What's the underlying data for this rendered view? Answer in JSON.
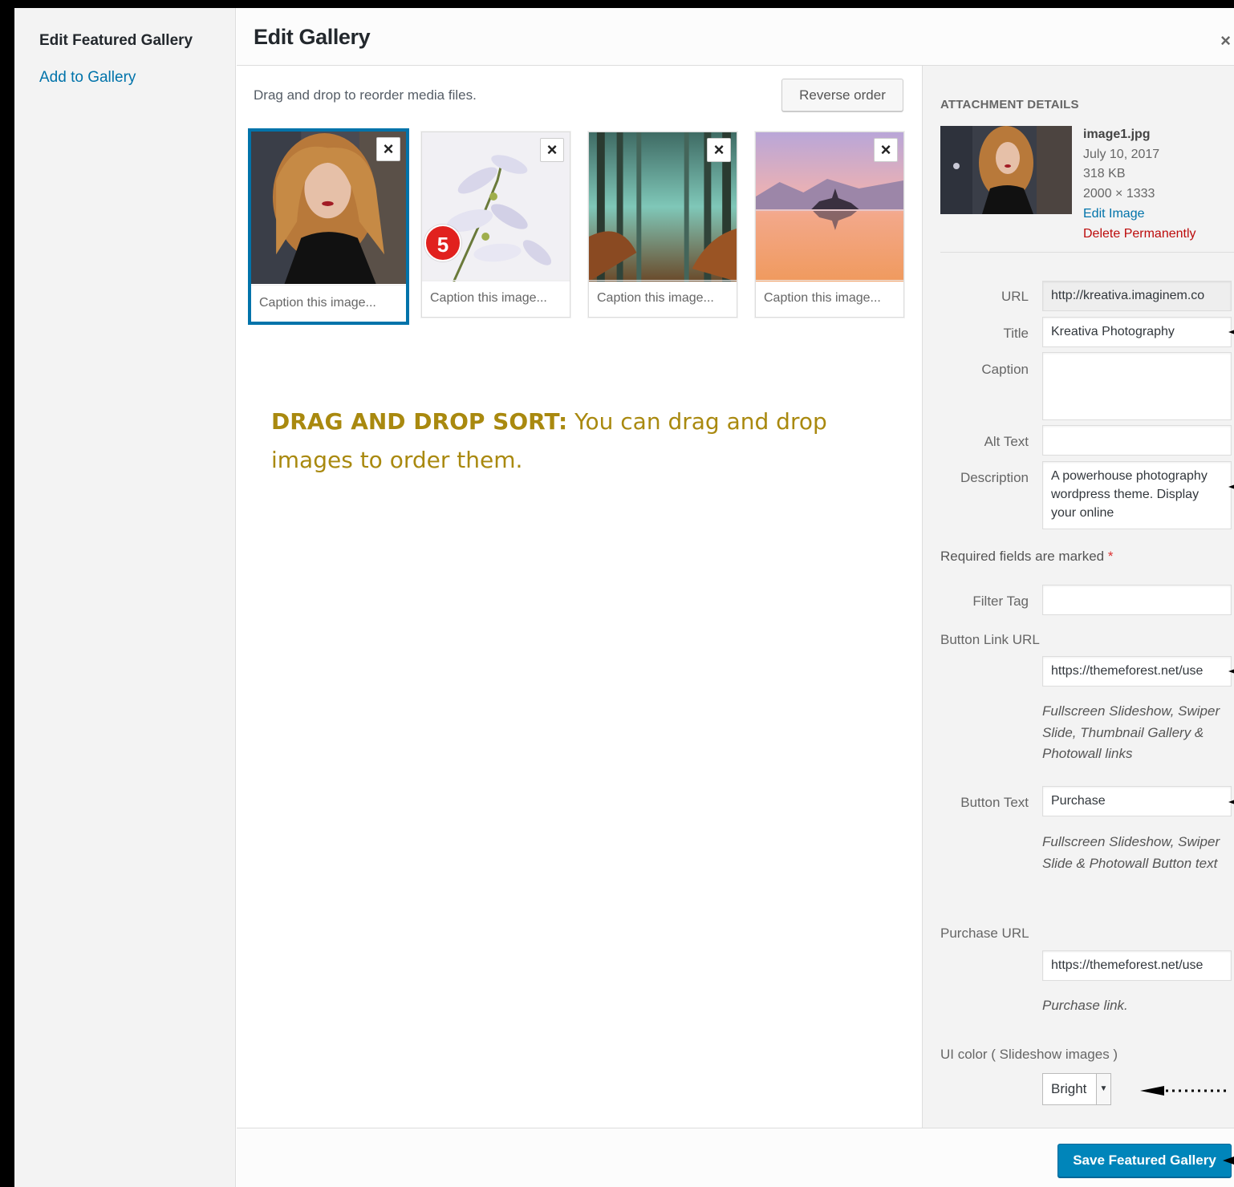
{
  "menu": {
    "heading": "Edit Featured Gallery",
    "add_link": "Add to Gallery"
  },
  "title": "Edit Gallery",
  "close_icon": "×",
  "content": {
    "instructions": "Drag and drop to reorder media files.",
    "reverse_label": "Reverse order",
    "thumbnails": [
      {
        "caption_placeholder": "Caption this image...",
        "remove_icon": "×",
        "selected": true,
        "subject": "portrait-woman"
      },
      {
        "caption_placeholder": "Caption this image...",
        "remove_icon": "×",
        "selected": false,
        "subject": "white-flowers"
      },
      {
        "caption_placeholder": "Caption this image...",
        "remove_icon": "×",
        "selected": false,
        "subject": "misty-forest"
      },
      {
        "caption_placeholder": "Caption this image...",
        "remove_icon": "×",
        "selected": false,
        "subject": "lake-island-sunset"
      }
    ],
    "step_badge": "5",
    "annotation_bold": "DRAG AND DROP SORT:",
    "annotation_text": " You can drag and drop images to order them."
  },
  "sidebar": {
    "section_title": "Attachment Details",
    "filename": "image1.jpg",
    "date": "July 10, 2017",
    "filesize": "318 KB",
    "dimensions": "2000 × 1333",
    "edit_link": "Edit Image",
    "delete_link": "Delete Permanently",
    "fields": {
      "url_label": "URL",
      "url_value": "http://kreativa.imaginem.co",
      "title_label": "Title",
      "title_value": "Kreativa Photography",
      "caption_label": "Caption",
      "caption_value": "",
      "alt_label": "Alt Text",
      "alt_value": "",
      "description_label": "Description",
      "description_value": "A powerhouse photography wordpress theme. Display your online"
    },
    "required_note": "Required fields are marked ",
    "required_star": "*",
    "filter_tag_label": "Filter Tag",
    "filter_tag_value": "",
    "button_link_label": "Button Link URL",
    "button_link_value": "https://themeforest.net/use",
    "button_link_help": "Fullscreen Slideshow, Swiper Slide, Thumbnail Gallery & Photowall links",
    "button_text_label": "Button Text",
    "button_text_value": "Purchase",
    "button_text_help": "Fullscreen Slideshow, Swiper Slide & Photowall Button text",
    "purchase_url_label": "Purchase URL",
    "purchase_url_value": "https://themeforest.net/use",
    "purchase_url_help": "Purchase link.",
    "ui_color_label": "UI color ( Slideshow images )",
    "ui_color_value": "Bright"
  },
  "footer": {
    "save_label": "Save Featured Gallery"
  },
  "colors": {
    "accent": "#0073aa",
    "primary_button": "#0085ba",
    "annotation": "#a9890f",
    "badge": "#e1211e",
    "delete": "#bc0b0b"
  }
}
